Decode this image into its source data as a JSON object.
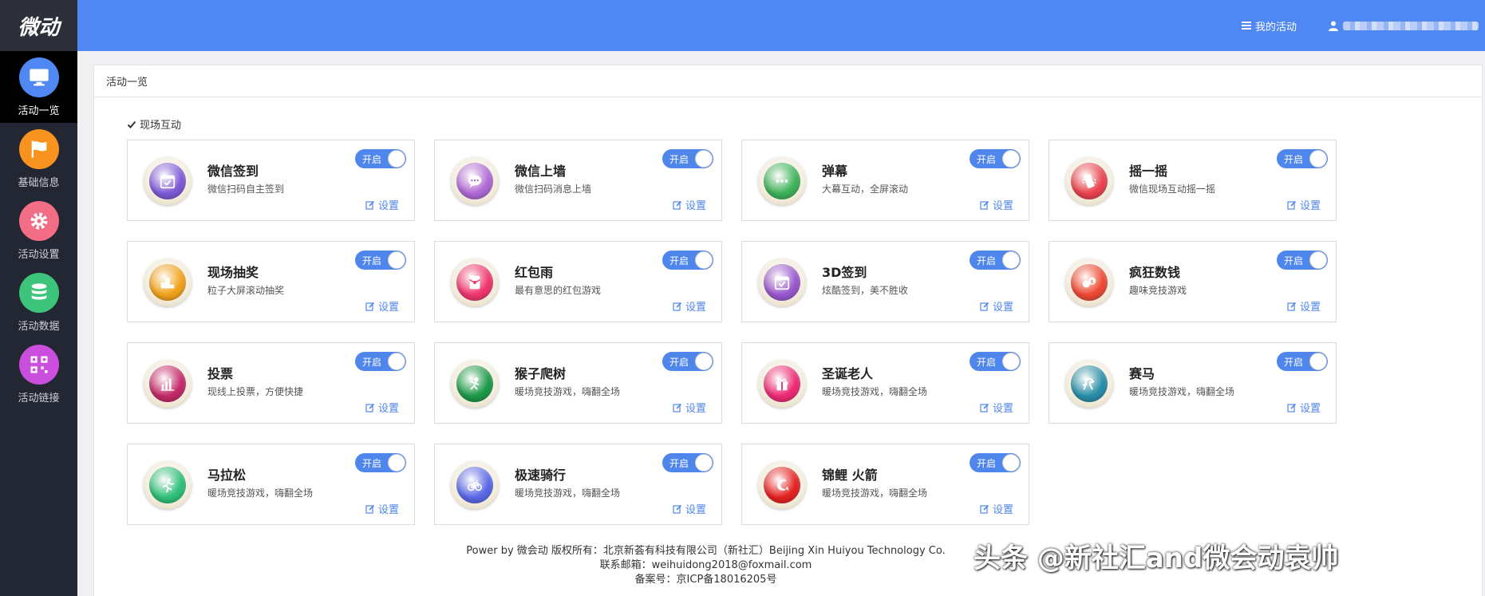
{
  "sidebar": {
    "logo": "微动",
    "items": [
      {
        "label": "活动一览",
        "icon": "monitor-icon",
        "color": "#4f88f3",
        "active": true
      },
      {
        "label": "基础信息",
        "icon": "flag-icon",
        "color": "#f7931e",
        "active": false
      },
      {
        "label": "活动设置",
        "icon": "gear-icon",
        "color": "#f26d85",
        "active": false
      },
      {
        "label": "活动数据",
        "icon": "database-icon",
        "color": "#3cc57a",
        "active": false
      },
      {
        "label": "活动链接",
        "icon": "qrcode-icon",
        "color": "#c94fdc",
        "active": false
      }
    ]
  },
  "topbar": {
    "my_activities": "我的活动",
    "user_icon": "user-icon",
    "menu_icon": "menu-icon"
  },
  "panel": {
    "title": "活动一览",
    "section": "现场互动",
    "toggle_label": "开启",
    "settings_label": "设置",
    "cards": [
      {
        "title": "微信签到",
        "desc": "微信扫码自主签到",
        "icon": "calendar-check-icon",
        "color": "#7e5bd8"
      },
      {
        "title": "微信上墙",
        "desc": "微信扫码消息上墙",
        "icon": "chat-icon",
        "color": "#b06ad6"
      },
      {
        "title": "弹幕",
        "desc": "大幕互动，全屏滚动",
        "icon": "dots-icon",
        "color": "#3eb35a"
      },
      {
        "title": "摇一摇",
        "desc": "微信现场互动摇一摇",
        "icon": "shake-phone-icon",
        "color": "#e9434f"
      },
      {
        "title": "现场抽奖",
        "desc": "粒子大屏滚动抽奖",
        "icon": "podium-icon",
        "color": "#f2a31b"
      },
      {
        "title": "红包雨",
        "desc": "最有意思的红包游戏",
        "icon": "red-envelope-icon",
        "color": "#f0366e"
      },
      {
        "title": "3D签到",
        "desc": "炫酷签到，美不胜收",
        "icon": "calendar-check-icon",
        "color": "#9a58cf"
      },
      {
        "title": "疯狂数钱",
        "desc": "趣味竞技游戏",
        "icon": "money-icon",
        "color": "#ee4a34"
      },
      {
        "title": "投票",
        "desc": "现线上投票，方便快捷",
        "icon": "bar-chart-icon",
        "color": "#c42a6a"
      },
      {
        "title": "猴子爬树",
        "desc": "暖场竞技游戏，嗨翻全场",
        "icon": "monkey-icon",
        "color": "#1d9a48"
      },
      {
        "title": "圣诞老人",
        "desc": "暖场竞技游戏，嗨翻全场",
        "icon": "gift-icon",
        "color": "#ee2a76"
      },
      {
        "title": "赛马",
        "desc": "暖场竞技游戏，嗨翻全场",
        "icon": "horse-icon",
        "color": "#2a8ea8"
      },
      {
        "title": "马拉松",
        "desc": "暖场竞技游戏，嗨翻全场",
        "icon": "runner-icon",
        "color": "#2fc07a"
      },
      {
        "title": "极速骑行",
        "desc": "暖场竞技游戏，嗨翻全场",
        "icon": "bicycle-icon",
        "color": "#5a6ae8"
      },
      {
        "title": "锦鲤 火箭",
        "desc": "暖场竞技游戏，嗨翻全场",
        "icon": "koi-icon",
        "color": "#e52222"
      }
    ]
  },
  "footer": {
    "line1": "Power by 微会动 版权所有：北京新荟有科技有限公司（新社汇）Beijing Xin Huiyou Technology Co.",
    "line2": "联系邮箱：weihuidong2018@foxmail.com",
    "line3": "备案号：京ICP备18016205号"
  },
  "watermark": "头条 @新社汇and微会动袁帅"
}
